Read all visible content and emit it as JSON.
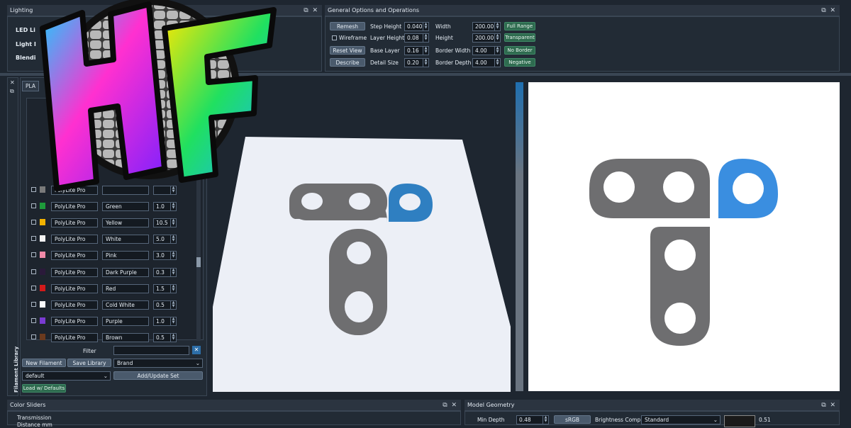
{
  "lighting_panel": {
    "title": "Lighting",
    "items": [
      "LED Li",
      "Light I",
      "Blendi"
    ]
  },
  "general_panel": {
    "title": "General Options and Operations",
    "buttons": {
      "remesh": "Remesh",
      "reset_view": "Reset View",
      "describe": "Describe"
    },
    "wireframe_label": "Wireframe",
    "fields": [
      {
        "label": "Step Height",
        "value": "0.040"
      },
      {
        "label": "Layer Height",
        "value": "0.08"
      },
      {
        "label": "Base Layer",
        "value": "0.16"
      },
      {
        "label": "Detail Size",
        "value": "0.20"
      }
    ],
    "dims": [
      {
        "label": "Width",
        "value": "200.00",
        "toggle": "Full Range"
      },
      {
        "label": "Height",
        "value": "200.00",
        "toggle": "Transparent"
      },
      {
        "label": "Border Width",
        "value": "4.00",
        "toggle": "No Border"
      },
      {
        "label": "Border Depth",
        "value": "4.00",
        "toggle": "Negative"
      }
    ]
  },
  "filament_library": {
    "tab": "PLA",
    "side_label": "Filament Library",
    "rows": [
      {
        "brand": "PolyLite Pro",
        "name": "",
        "value": "",
        "color": "#7a7a7a"
      },
      {
        "brand": "PolyLite Pro",
        "name": "Green",
        "value": "1.0",
        "color": "#1e9a3a"
      },
      {
        "brand": "PolyLite Pro",
        "name": "Yellow",
        "value": "10.5",
        "color": "#f2b200"
      },
      {
        "brand": "PolyLite Pro",
        "name": "White",
        "value": "5.0",
        "color": "#f3f3f3"
      },
      {
        "brand": "PolyLite Pro",
        "name": "Pink",
        "value": "3.0",
        "color": "#f08aa8"
      },
      {
        "brand": "PolyLite Pro",
        "name": "Dark Purple",
        "value": "0.3",
        "color": "#2a1a3a"
      },
      {
        "brand": "PolyLite Pro",
        "name": "Red",
        "value": "1.5",
        "color": "#d21a1a"
      },
      {
        "brand": "PolyLite Pro",
        "name": "Cold White",
        "value": "0.5",
        "color": "#fafafa"
      },
      {
        "brand": "PolyLite Pro",
        "name": "Purple",
        "value": "1.0",
        "color": "#7a3bd2"
      },
      {
        "brand": "PolyLite Pro",
        "name": "Brown",
        "value": "0.5",
        "color": "#6b3a1e"
      }
    ],
    "filter_label": "Filter",
    "new_filament": "New Filament",
    "save_library": "Save Library",
    "sort_value": "Brand",
    "set_value": "default",
    "add_update_set": "Add/Update Set",
    "load_defaults": "Load w/ Defaults"
  },
  "color_sliders": {
    "title": "Color Sliders",
    "label_line1": "Transmission",
    "label_line2": "Distance mm"
  },
  "model_geometry": {
    "title": "Model Geometry",
    "min_depth_label": "Min Depth",
    "min_depth_value": "0.48",
    "srgb_button": "sRGB",
    "brightness_label": "Brightness Comp",
    "brightness_value": "Standard",
    "side_value": "0.51"
  },
  "logo": {
    "text": "HF"
  },
  "colors": {
    "accent_blue": "#3a8ee0",
    "shape_gray": "#6e6e70",
    "bg": "#1e2630"
  },
  "icons": {
    "pin": "pin-icon",
    "close": "close-icon",
    "clear_filter": "clear-filter-icon"
  }
}
